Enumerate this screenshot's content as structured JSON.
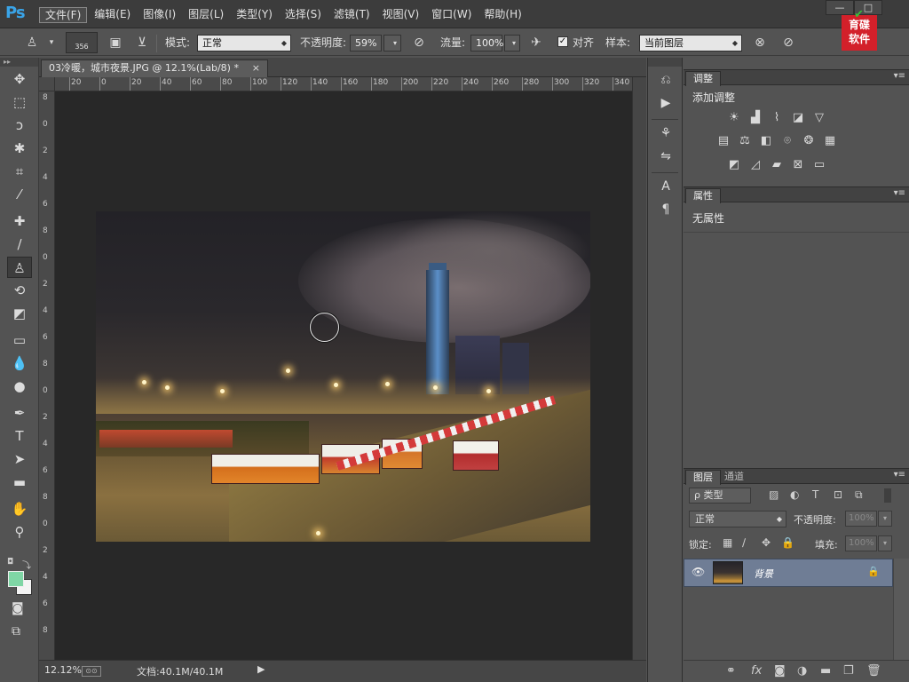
{
  "menubar": {
    "logo": "Ps",
    "items": [
      {
        "label": "文件(F)",
        "active": true
      },
      {
        "label": "编辑(E)"
      },
      {
        "label": "图像(I)"
      },
      {
        "label": "图层(L)"
      },
      {
        "label": "类型(Y)"
      },
      {
        "label": "选择(S)"
      },
      {
        "label": "滤镜(T)"
      },
      {
        "label": "视图(V)"
      },
      {
        "label": "窗口(W)"
      },
      {
        "label": "帮助(H)"
      }
    ],
    "window_controls": [
      "—",
      "□",
      "✕"
    ],
    "brand_logo": "育碟软件"
  },
  "options": {
    "brush_size": "356",
    "mode_label": "模式:",
    "mode_value": "正常",
    "opacity_label": "不透明度:",
    "opacity_value": "59%",
    "flow_label": "流量:",
    "flow_value": "100%",
    "aligned_label": "对齐",
    "aligned_checked": true,
    "sample_label": "样本:",
    "sample_value": "当前图层"
  },
  "document": {
    "tab_title": "03冷暖，城市夜景.JPG @ 12.1%(Lab/8) *",
    "tab_close": "×",
    "zoom": "12.12%",
    "doc_size": "文档:40.1M/40.1M",
    "status_arrow": "▶",
    "ruler_top": [
      "20",
      "0",
      "20",
      "40",
      "60",
      "80",
      "100",
      "120",
      "140",
      "160",
      "180",
      "200",
      "220",
      "240",
      "260",
      "280",
      "300",
      "320",
      "340"
    ],
    "ruler_left": [
      "8",
      "0",
      "2",
      "4",
      "6",
      "8",
      "0",
      "2",
      "4",
      "6",
      "8",
      "0",
      "2",
      "4",
      "6",
      "8",
      "0",
      "2",
      "4",
      "6",
      "8"
    ]
  },
  "toolbox": {
    "tools": [
      {
        "name": "move-tool",
        "icon": "move-icon",
        "glyph": "✥"
      },
      {
        "name": "marquee-tool",
        "icon": "marquee-icon",
        "glyph": "⬚"
      },
      {
        "name": "lasso-tool",
        "icon": "lasso-icon",
        "glyph": "ↄ"
      },
      {
        "name": "magic-wand-tool",
        "icon": "magic-wand-icon",
        "glyph": "✱"
      },
      {
        "name": "crop-tool",
        "icon": "crop-icon",
        "glyph": "⌗"
      },
      {
        "name": "eyedropper-tool",
        "icon": "eyedropper-icon",
        "glyph": "⁄"
      },
      {
        "name": "healing-tool",
        "icon": "healing-icon",
        "glyph": "✚"
      },
      {
        "name": "brush-tool",
        "icon": "brush-icon",
        "glyph": "∕"
      },
      {
        "name": "clone-stamp-tool",
        "icon": "clone-stamp-icon",
        "glyph": "♙",
        "active": true
      },
      {
        "name": "history-brush-tool",
        "icon": "history-brush-icon",
        "glyph": "⟲"
      },
      {
        "name": "eraser-tool",
        "icon": "eraser-icon",
        "glyph": "◩"
      },
      {
        "name": "gradient-tool",
        "icon": "gradient-icon",
        "glyph": "▭"
      },
      {
        "name": "blur-tool",
        "icon": "blur-icon",
        "glyph": "💧"
      },
      {
        "name": "dodge-tool",
        "icon": "dodge-icon",
        "glyph": "●"
      },
      {
        "name": "pen-tool",
        "icon": "pen-icon",
        "glyph": "✒"
      },
      {
        "name": "type-tool",
        "icon": "type-icon",
        "glyph": "T"
      },
      {
        "name": "path-select-tool",
        "icon": "path-select-icon",
        "glyph": "➤"
      },
      {
        "name": "shape-tool",
        "icon": "rectangle-shape-icon",
        "glyph": "▬"
      },
      {
        "name": "hand-tool",
        "icon": "hand-icon",
        "glyph": "✋"
      },
      {
        "name": "zoom-tool",
        "icon": "zoom-icon",
        "glyph": "⚲"
      }
    ],
    "foreground_color": "#7fd6a5",
    "background_color": "#f4f4f4"
  },
  "panels": {
    "adjustments_tab": "调整",
    "adjustments_title": "添加调整",
    "adjust_rows": [
      [
        {
          "name": "brightness-icon",
          "glyph": "☀"
        },
        {
          "name": "levels-icon",
          "glyph": "▟"
        },
        {
          "name": "curves-icon",
          "glyph": "⌇"
        },
        {
          "name": "exposure-icon",
          "glyph": "◪"
        },
        {
          "name": "vibrance-icon",
          "glyph": "▽"
        }
      ],
      [
        {
          "name": "hue-saturation-icon",
          "glyph": "▤"
        },
        {
          "name": "color-balance-icon",
          "glyph": "⚖"
        },
        {
          "name": "black-white-icon",
          "glyph": "◧"
        },
        {
          "name": "photo-filter-icon",
          "glyph": "⌾"
        },
        {
          "name": "channel-mixer-icon",
          "glyph": "❂"
        },
        {
          "name": "color-lookup-icon",
          "glyph": "▦"
        }
      ],
      [
        {
          "name": "invert-icon",
          "glyph": "◩"
        },
        {
          "name": "posterize-icon",
          "glyph": "◿"
        },
        {
          "name": "threshold-icon",
          "glyph": "▰"
        },
        {
          "name": "selective-color-icon",
          "glyph": "⊠"
        },
        {
          "name": "gradient-map-icon",
          "glyph": "▭"
        }
      ]
    ],
    "properties_tab": "属性",
    "properties_title": "无属性",
    "layers_tab": "图层",
    "channels_tab": "通道",
    "filter_kind": "ρ 类型",
    "blend_mode": "正常",
    "opacity_label": "不透明度:",
    "opacity_value": "100%",
    "lock_label": "锁定:",
    "fill_label": "填充:",
    "fill_value": "100%",
    "layer_name": "背景",
    "layer_lock": "🔒",
    "panel_menu": "▾≡"
  }
}
